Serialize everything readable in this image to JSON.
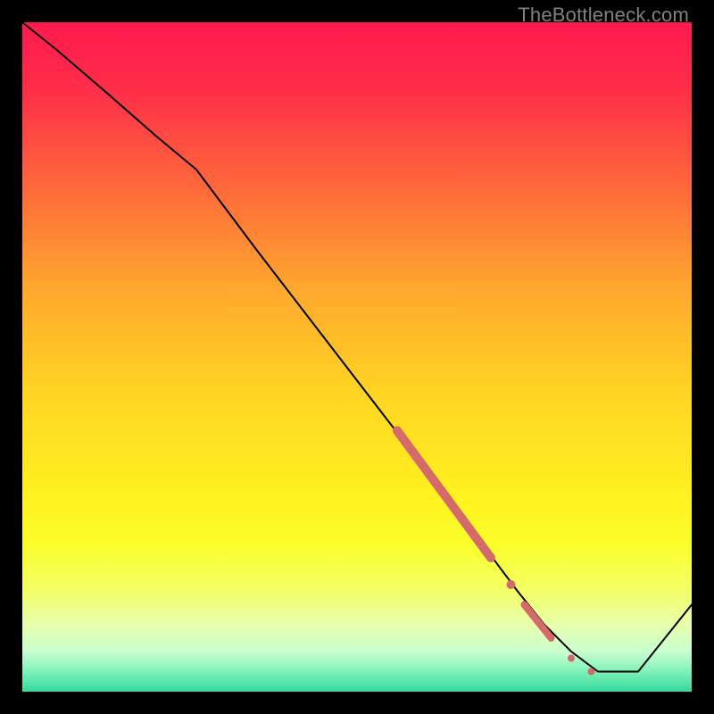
{
  "watermark": "TheBottleneck.com",
  "chart_data": {
    "type": "line",
    "title": "",
    "xlabel": "",
    "ylabel": "",
    "xlim": [
      0,
      100
    ],
    "ylim": [
      0,
      100
    ],
    "grid": false,
    "legend": false,
    "background": {
      "type": "vertical-gradient",
      "stops": [
        {
          "pos": 0.0,
          "color": "#ff1a4e"
        },
        {
          "pos": 0.1,
          "color": "#ff2e49"
        },
        {
          "pos": 0.25,
          "color": "#ff6a3a"
        },
        {
          "pos": 0.4,
          "color": "#ffa82e"
        },
        {
          "pos": 0.55,
          "color": "#ffd423"
        },
        {
          "pos": 0.7,
          "color": "#fff01f"
        },
        {
          "pos": 0.78,
          "color": "#fbff2a"
        },
        {
          "pos": 0.85,
          "color": "#f2ff66"
        },
        {
          "pos": 0.9,
          "color": "#e8ffad"
        },
        {
          "pos": 0.94,
          "color": "#c9ffcf"
        },
        {
          "pos": 0.97,
          "color": "#7ef2b8"
        },
        {
          "pos": 1.0,
          "color": "#35d89b"
        }
      ]
    },
    "series": [
      {
        "name": "curve",
        "color": "#000000",
        "stroke_width": 2,
        "x": [
          0,
          5,
          12,
          20,
          26,
          35,
          45,
          55,
          62,
          68,
          74,
          78,
          82,
          86,
          92,
          100
        ],
        "values": [
          100,
          96,
          90,
          83,
          78,
          66,
          53,
          40,
          31,
          23,
          15,
          10,
          6,
          3,
          3,
          13
        ]
      }
    ],
    "markers": [
      {
        "name": "thick-segment",
        "color": "#d46a6a",
        "shape": "round-thick-line",
        "width": 10,
        "x1": 56,
        "y1": 39,
        "x2": 70,
        "y2": 20
      },
      {
        "name": "dot-1",
        "color": "#d46a6a",
        "shape": "circle",
        "r": 5,
        "x": 73,
        "y": 16
      },
      {
        "name": "thick-segment-2",
        "color": "#d46a6a",
        "shape": "round-thick-line",
        "width": 8,
        "x1": 75,
        "y1": 13,
        "x2": 79,
        "y2": 8
      },
      {
        "name": "dot-2",
        "color": "#d46a6a",
        "shape": "circle",
        "r": 4,
        "x": 82,
        "y": 5
      },
      {
        "name": "dot-3",
        "color": "#d46a6a",
        "shape": "circle",
        "r": 4,
        "x": 85,
        "y": 3
      }
    ]
  }
}
